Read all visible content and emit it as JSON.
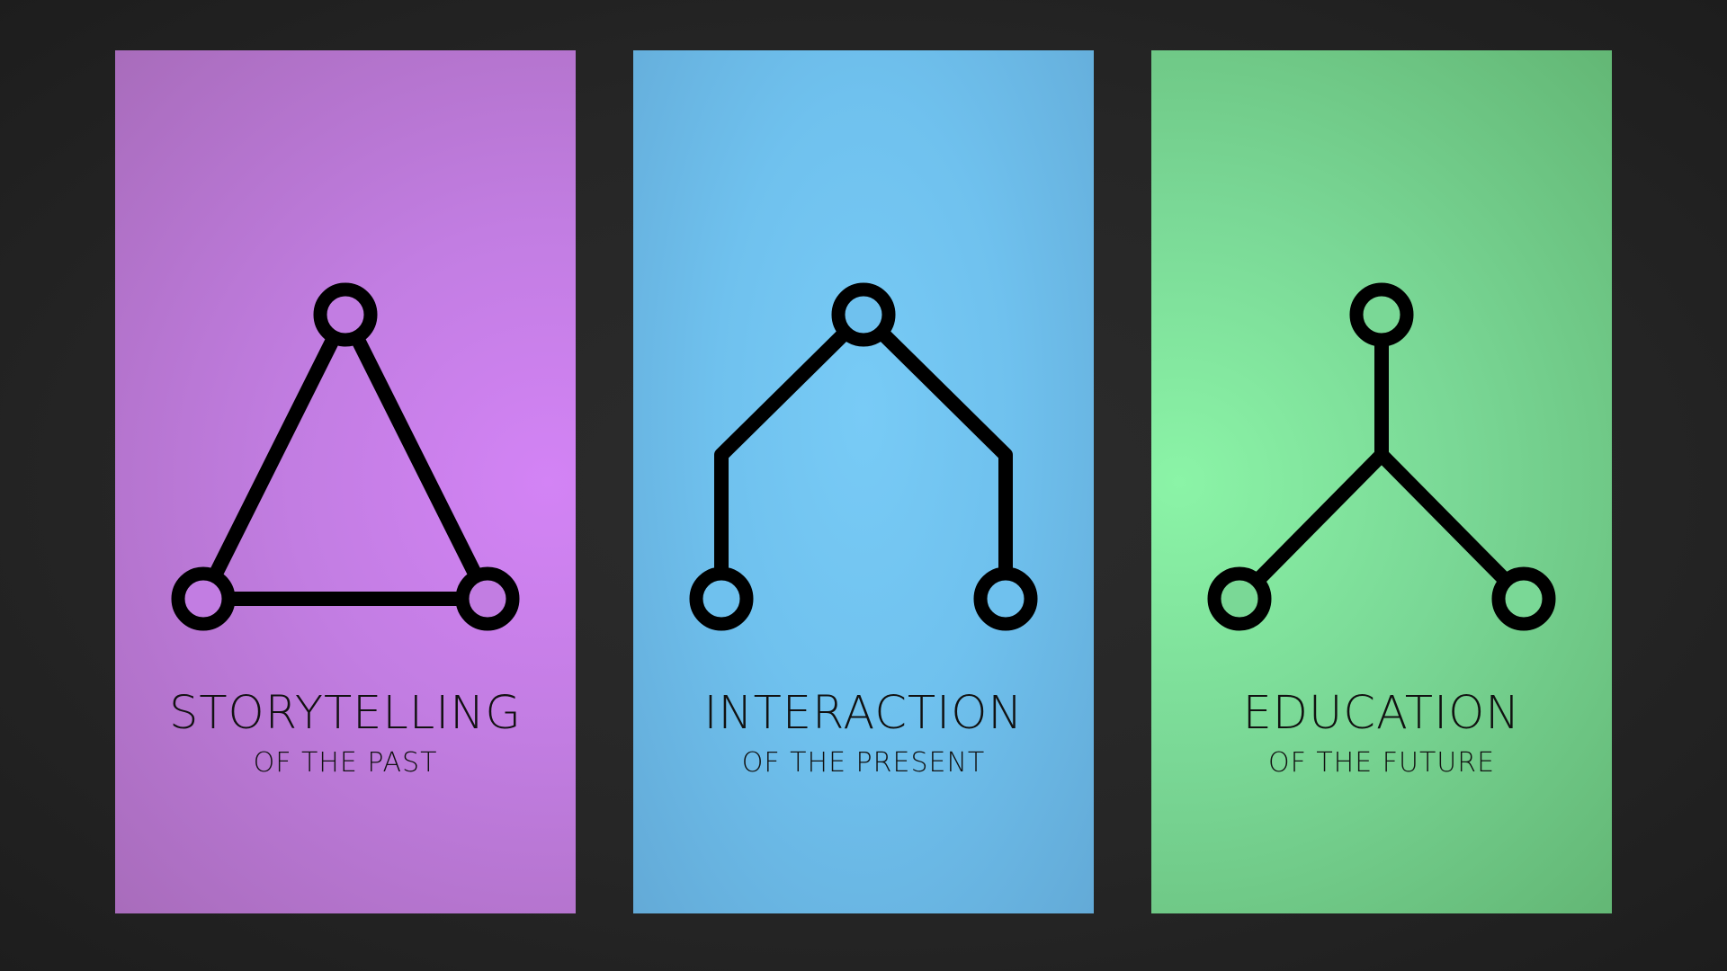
{
  "panels": [
    {
      "title": "STORYTELLING",
      "subtitle": "OF THE PAST",
      "icon": "triangle-network-icon",
      "color": "#c27de2"
    },
    {
      "title": "INTERACTION",
      "subtitle": "OF THE PRESENT",
      "icon": "arch-network-icon",
      "color": "#6fc1ee"
    },
    {
      "title": "EDUCATION",
      "subtitle": "OF THE FUTURE",
      "icon": "y-branch-network-icon",
      "color": "#7ad896"
    }
  ]
}
